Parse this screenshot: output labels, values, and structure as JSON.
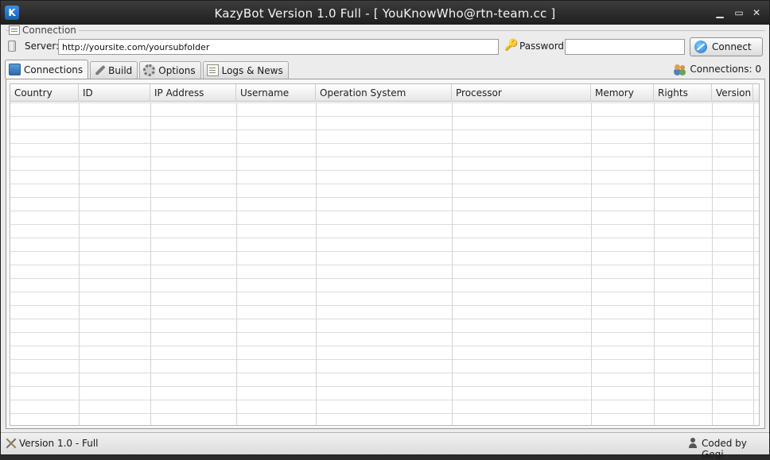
{
  "window": {
    "title": "KazyBot Version 1.0 Full - [ YouKnowWho@rtn-team.cc ]",
    "app_icon": "K",
    "controls": {
      "minimize": "▁",
      "maximize": "▭",
      "close": "✕"
    }
  },
  "connection": {
    "group_label": "Connection",
    "server_label": "Server:",
    "server_value": "http://yoursite.com/yoursubfolder",
    "password_label": "Password:",
    "password_value": "",
    "connect_label": "Connect"
  },
  "tabs": [
    {
      "label": "Connections",
      "icon": "network-icon",
      "active": true
    },
    {
      "label": "Build",
      "icon": "wrench-icon",
      "active": false
    },
    {
      "label": "Options",
      "icon": "gear-icon",
      "active": false
    },
    {
      "label": "Logs & News",
      "icon": "clipboard-icon",
      "active": false
    }
  ],
  "connections_count": "Connections: 0",
  "grid": {
    "columns": [
      "Country",
      "ID",
      "IP Address",
      "Username",
      "Operation System",
      "Processor",
      "Memory",
      "Rights",
      "Version"
    ],
    "rows": []
  },
  "status": {
    "left": "Version 1.0 - Full",
    "right": "Coded by Gegi"
  }
}
